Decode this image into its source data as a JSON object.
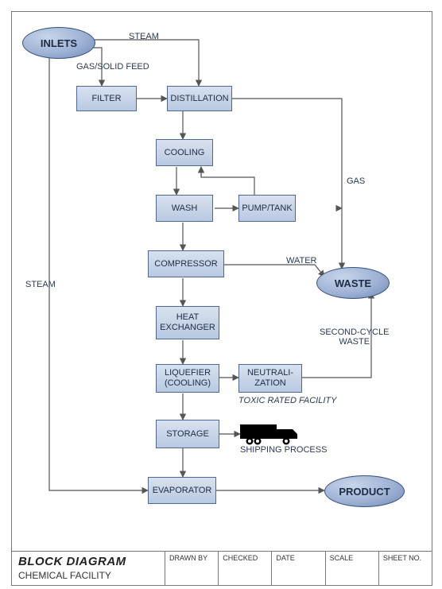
{
  "nodes": {
    "inlets": "INLETS",
    "filter": "FILTER",
    "distillation": "DISTILLATION",
    "cooling": "COOLING",
    "wash": "WASH",
    "pumptank": "PUMP/TANK",
    "compressor": "COMPRESSOR",
    "heat_exchanger": "HEAT\nEXCHANGER",
    "liquefier": "LIQUEFIER\n(COOLING)",
    "neutralization": "NEUTRALI-\nZATION",
    "storage": "STORAGE",
    "evaporator": "EVAPORATOR",
    "waste": "WASTE",
    "product": "PRODUCT"
  },
  "edge_labels": {
    "steam_top": "STEAM",
    "gas_solid_feed": "GAS/SOLID FEED",
    "steam_left": "STEAM",
    "gas": "GAS",
    "water": "WATER",
    "second_cycle_waste": "SECOND-CYCLE\nWASTE",
    "toxic": "TOXIC RATED FACILITY",
    "shipping": "SHIPPING PROCESS"
  },
  "titleblock": {
    "title_line1": "BLOCK DIAGRAM",
    "title_line2": "CHEMICAL FACILITY",
    "drawn_by": "DRAWN BY",
    "checked": "CHECKED",
    "date": "DATE",
    "scale": "SCALE",
    "sheet_no": "SHEET NO."
  }
}
